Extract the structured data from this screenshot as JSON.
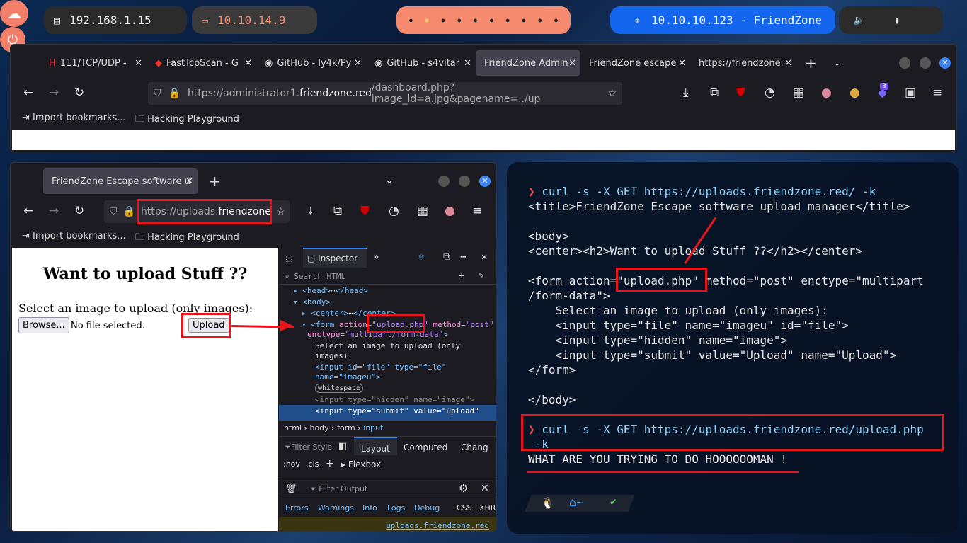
{
  "topbar": {
    "local_ip": "192.168.1.15",
    "vpn_ip": "10.10.14.9",
    "target": "10.10.10.123 - FriendZone"
  },
  "browser1": {
    "tabs": [
      "111/TCP/UDP - ",
      "FastTcpScan - G",
      "GitHub - ly4k/Py",
      "GitHub - s4vitar",
      "FriendZone Admin",
      "FriendZone escape",
      "https://friendzone."
    ],
    "url_pre": "https://administrator1.",
    "url_host": "friendzone.red",
    "url_post": "/dashboard.php?image_id=a.jpg&pagename=../up",
    "bookmarks": [
      "Import bookmarks...",
      "Hacking Playground"
    ],
    "badge": "3"
  },
  "browser2": {
    "tab": "FriendZone Escape software u",
    "url_pre": "https://uploads.",
    "url_host": "friendzone",
    "bookmarks": [
      "Import bookmarks...",
      "Hacking Playground"
    ],
    "page": {
      "heading": "Want to upload Stuff ??",
      "prompt": "Select an image to upload (only images):",
      "browse": "Browse...",
      "no_file": "No file selected.",
      "upload": "Upload"
    },
    "devtools": {
      "inspector": "Inspector",
      "search": "Search HTML",
      "lines": [
        "<head>",
        "</head>",
        "<body>",
        "<center>",
        "</center>"
      ],
      "form_action": "upload.php",
      "form_method": "post",
      "form_enctype": "multipart/form-data",
      "text1": "Select an image to upload (only",
      "text2": "images):",
      "in1a": "<input id=\"file\" type=\"file\"",
      "in1b": "name=\"imageu\">",
      "ws": "whitespace",
      "in2": "<input type=\"hidden\" name=\"image\">",
      "in3": "<input type=\"submit\" value=\"Upload\"",
      "crumbs": [
        "html",
        "body",
        "form",
        "input"
      ],
      "filter": "Filter Style",
      "panes": [
        "Layout",
        "Computed",
        "Chang"
      ],
      "hov": ":hov",
      ".cls": ".cls",
      "flexbox": "Flexbox",
      "filter_out": "Filter Output",
      "console_tabs": [
        "Errors",
        "Warnings",
        "Info",
        "Logs",
        "Debug",
        "CSS",
        "XHR"
      ],
      "link": "uploads.friendzone.red"
    }
  },
  "terminal": {
    "l1": "curl -s -X GET https://uploads.friendzone.red/ -k",
    "l2": "<title>FriendZone Escape software upload manager</title>",
    "l3": "<body>",
    "l4": "<center><h2>Want to upload Stuff ??</h2></center>",
    "l5a": "<form action=",
    "l5b": "\"upload.php\"",
    "l5c": " method=\"post\" enctype=\"multipart",
    "l6": "/form-data\">",
    "l7": "    Select an image to upload (only images):",
    "l8": "    <input type=\"file\" name=\"imageu\" id=\"file\">",
    "l9": "    <input type=\"hidden\" name=\"image\">",
    "l10": "    <input type=\"submit\" value=\"Upload\" name=\"Upload\">",
    "l11": "</form>",
    "l12": "</body>",
    "l13": "curl -s -X GET https://uploads.friendzone.red/upload.php",
    "l14": " -k",
    "l15": "WHAT ARE YOU TRYING TO DO HOOOOOOMAN !",
    "home": "~"
  }
}
